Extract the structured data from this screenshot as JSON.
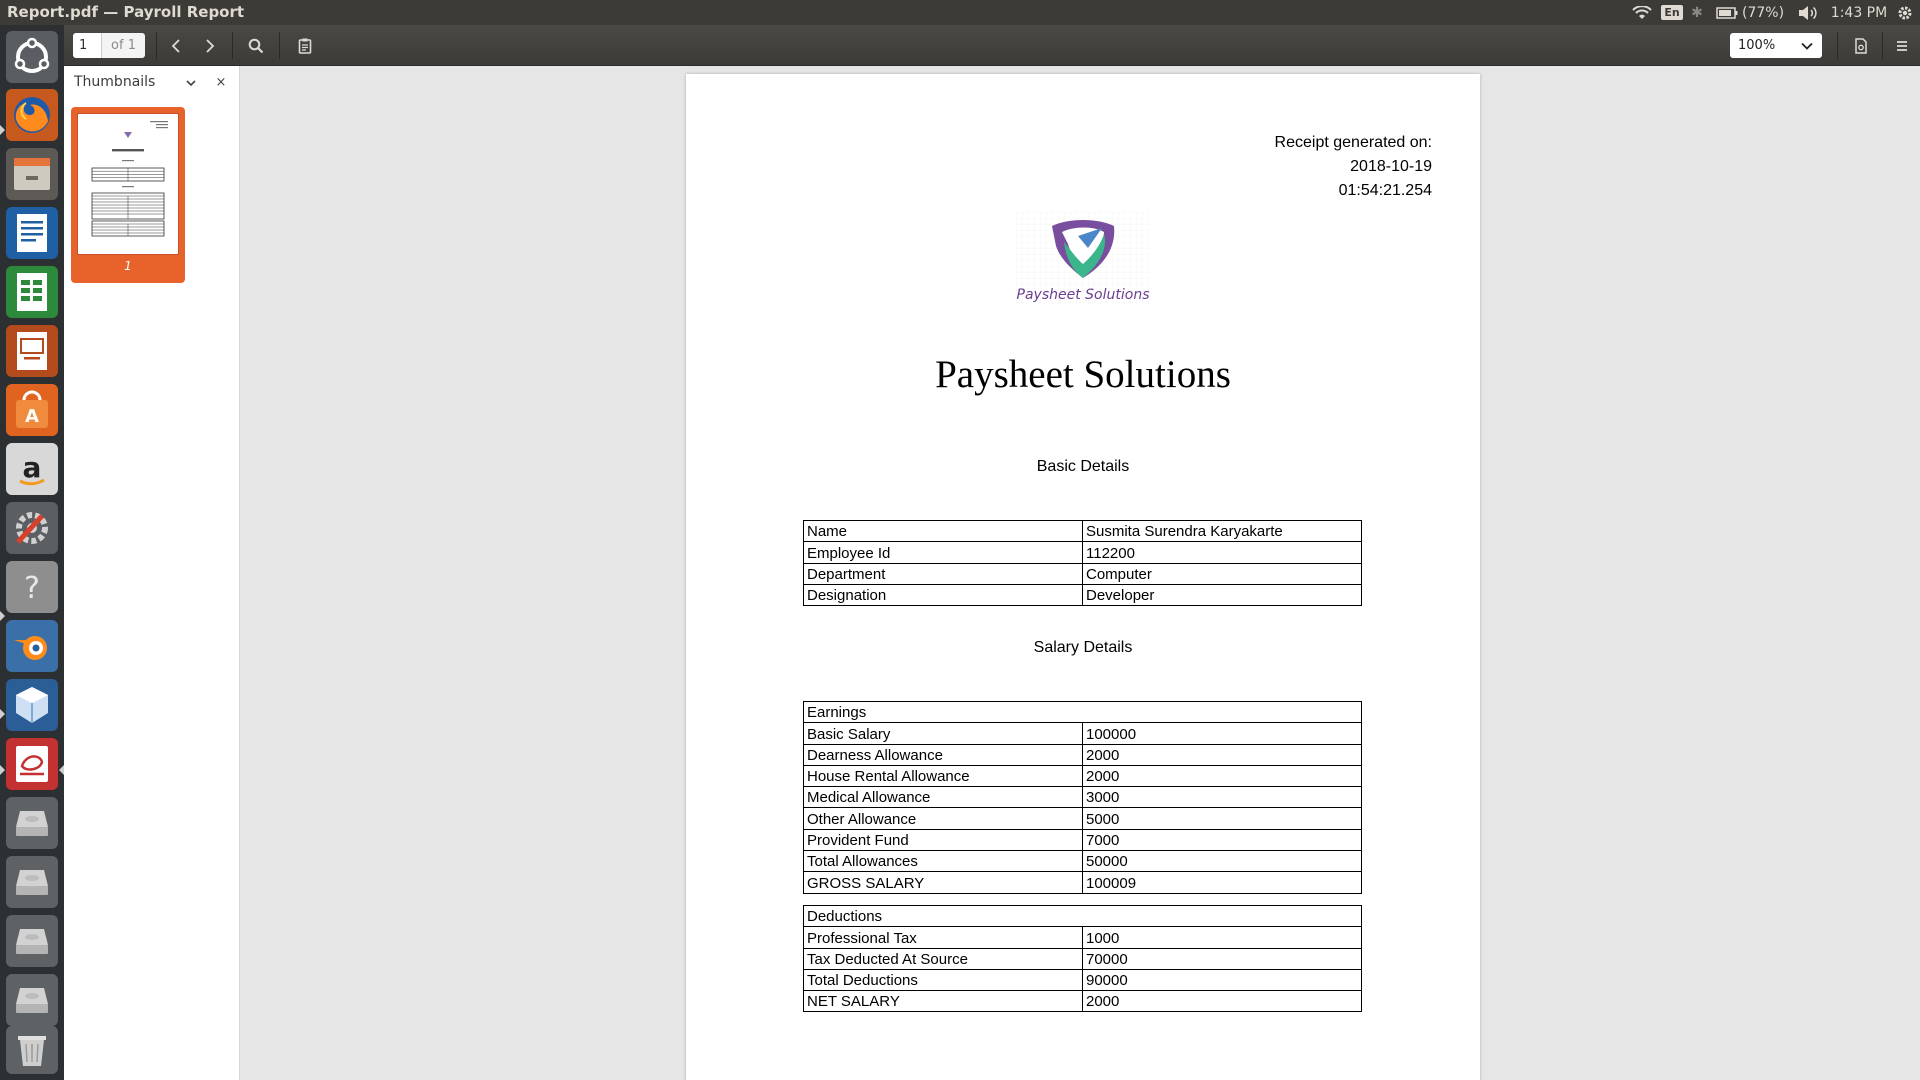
{
  "window": {
    "title": "Report.pdf — Payroll Report"
  },
  "top_panel": {
    "language": "En",
    "battery": "(77%)",
    "clock": "1:43 PM"
  },
  "launcher": {
    "items": [
      "ubuntu-dash",
      "firefox",
      "files",
      "libreoffice-writer",
      "libreoffice-calc",
      "libreoffice-impress",
      "ubuntu-software",
      "amazon",
      "system-settings",
      "help",
      "blender",
      "virtualbox",
      "document-viewer",
      "drive-1",
      "drive-2",
      "drive-3",
      "drive-4",
      "trash"
    ]
  },
  "toolbar": {
    "page_value": "1",
    "page_of": "of 1",
    "zoom": "100%"
  },
  "sidebar": {
    "title": "Thumbnails",
    "close_glyph": "×",
    "thumbnail_page_number": "1"
  },
  "document": {
    "receipt_label": "Receipt generated on:",
    "receipt_date": "2018-10-19",
    "receipt_time": "01:54:21.254",
    "logo_caption": "Paysheet Solutions",
    "company_title": "Paysheet Solutions",
    "basic_heading": "Basic Details",
    "basic_rows": [
      {
        "label": "Name",
        "value": "Susmita Surendra Karyakarte"
      },
      {
        "label": "Employee Id",
        "value": "112200"
      },
      {
        "label": "Department",
        "value": "Computer"
      },
      {
        "label": "Designation",
        "value": "Developer"
      }
    ],
    "salary_heading": "Salary Details",
    "earnings_heading": "Earnings",
    "earnings_rows": [
      {
        "label": "Basic Salary",
        "value": "100000"
      },
      {
        "label": "Dearness Allowance",
        "value": "2000"
      },
      {
        "label": "House Rental Allowance",
        "value": "2000"
      },
      {
        "label": "Medical Allowance",
        "value": "3000"
      },
      {
        "label": "Other Allowance",
        "value": "5000"
      },
      {
        "label": "Provident Fund",
        "value": "7000"
      },
      {
        "label": "Total Allowances",
        "value": "50000"
      },
      {
        "label": "GROSS SALARY",
        "value": "100009"
      }
    ],
    "deductions_heading": "Deductions",
    "deductions_rows": [
      {
        "label": "Professional Tax",
        "value": "1000"
      },
      {
        "label": "Tax Deducted At Source",
        "value": "70000"
      },
      {
        "label": "Total Deductions",
        "value": "90000"
      },
      {
        "label": "NET SALARY",
        "value": "2000"
      }
    ]
  },
  "colors": {
    "accent_orange": "#e8632b",
    "panel_dark": "#3c3b37",
    "launcher_bg": "#2d3033",
    "logo_purple": "#6b3d8f",
    "logo_teal": "#3bb58c"
  }
}
